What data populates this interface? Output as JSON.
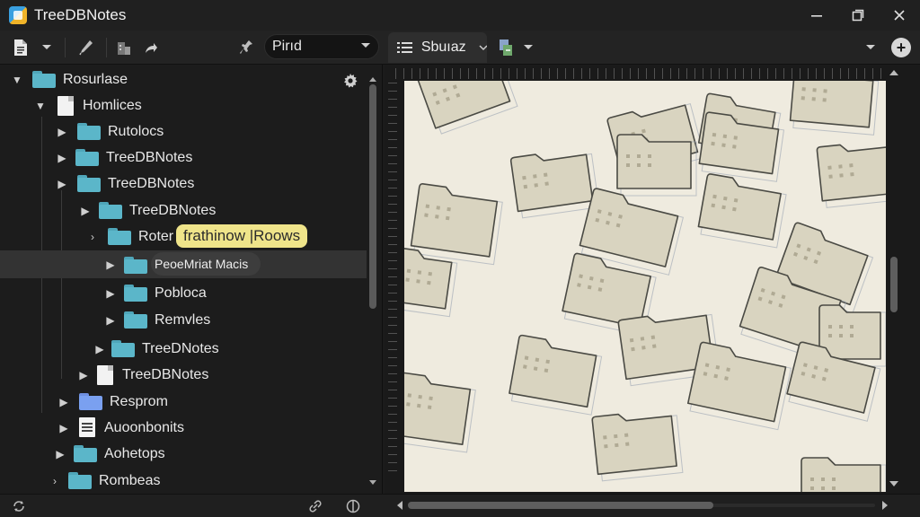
{
  "window": {
    "title": "TreeDBNotes",
    "controls": [
      "minimize",
      "maximize",
      "close"
    ]
  },
  "toolbar": {
    "pin_select_value": "Pirıd",
    "view_tab_label": "Sbuıaz"
  },
  "tree": {
    "root_label": "Rosurlase",
    "rows": [
      {
        "label": "Homlices",
        "icon": "page-icon"
      },
      {
        "label": "Rutolocs",
        "icon": "folder-icon"
      },
      {
        "label": "TreeDBNotes",
        "icon": "folder-icon"
      },
      {
        "label": "TreeDBNotes",
        "icon": "folder-icon"
      },
      {
        "label": "TreeDBNotes",
        "icon": "folder-icon"
      },
      {
        "label": "Roter",
        "icon": "folder-icon",
        "highlight": "frathinow |Roows"
      },
      {
        "label": "PeoeMriat Macis",
        "icon": "folder-icon",
        "selected": true
      },
      {
        "label": "Pobloca",
        "icon": "folder-icon"
      },
      {
        "label": "Remvles",
        "icon": "folder-icon"
      },
      {
        "label": "TreeDNotes",
        "icon": "folder-icon"
      },
      {
        "label": "TreeDBNotes",
        "icon": "page-icon"
      },
      {
        "label": "Resprom",
        "icon": "folder-icon-blue"
      },
      {
        "label": "Auoonbonits",
        "icon": "document-icon"
      },
      {
        "label": "Aohetops",
        "icon": "folder-icon"
      },
      {
        "label": "Rombeas",
        "icon": "folder-icon"
      }
    ]
  },
  "canvas": {
    "background_color": "#efebdf",
    "sticker_color": "#d9d4c0"
  },
  "colors": {
    "folder": "#5bb6c9",
    "highlight": "#efe48a",
    "selection": "#333333"
  }
}
